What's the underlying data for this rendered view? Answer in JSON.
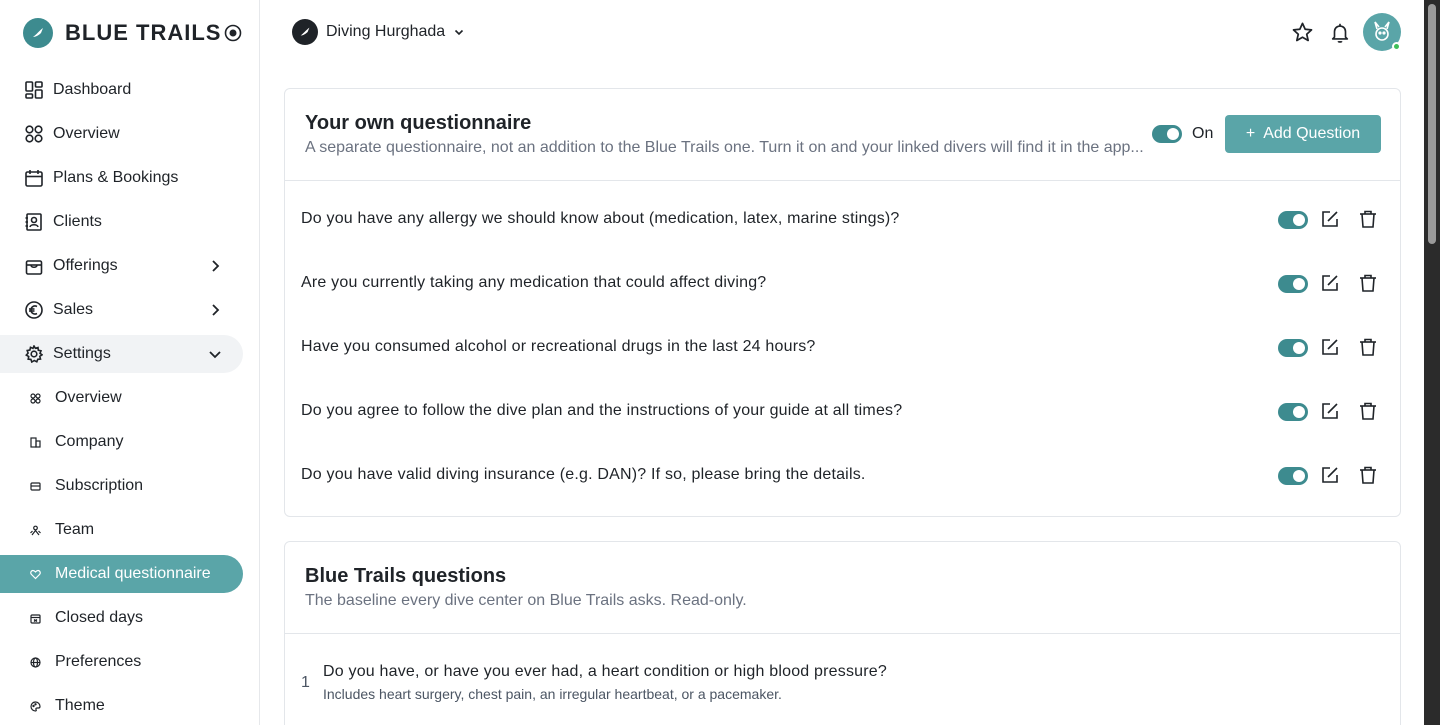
{
  "brand": {
    "name": "BLUE TRAILS"
  },
  "sidebar": {
    "items": [
      {
        "label": "Dashboard"
      },
      {
        "label": "Overview"
      },
      {
        "label": "Plans & Bookings"
      },
      {
        "label": "Clients"
      },
      {
        "label": "Offerings"
      },
      {
        "label": "Sales"
      },
      {
        "label": "Settings"
      }
    ],
    "settings_items": [
      {
        "label": "Overview"
      },
      {
        "label": "Company"
      },
      {
        "label": "Subscription"
      },
      {
        "label": "Team"
      },
      {
        "label": "Medical questionnaire"
      },
      {
        "label": "Closed days"
      },
      {
        "label": "Preferences"
      },
      {
        "label": "Theme"
      }
    ]
  },
  "header": {
    "center_name": "Diving Hurghada"
  },
  "own_questionnaire": {
    "title": "Your own questionnaire",
    "subtitle": "A separate questionnaire, not an addition to the Blue Trails one. Turn it on and your linked divers will find it in the app...",
    "toggle_label": "On",
    "add_button": "Add Question",
    "questions": [
      {
        "text": "Do you have any allergy we should know about (medication, latex, marine stings)?",
        "enabled": true
      },
      {
        "text": "Are you currently taking any medication that could affect diving?",
        "enabled": true
      },
      {
        "text": "Have you consumed alcohol or recreational drugs in the last 24 hours?",
        "enabled": true
      },
      {
        "text": "Do you agree to follow the dive plan and the instructions of your guide at all times?",
        "enabled": true
      },
      {
        "text": "Do you have valid diving insurance (e.g. DAN)? If so, please bring the details.",
        "enabled": true
      }
    ]
  },
  "blue_trails": {
    "title": "Blue Trails questions",
    "subtitle": "The baseline every dive center on Blue Trails asks. Read-only.",
    "questions": [
      {
        "number": "1",
        "text": "Do you have, or have you ever had, a heart condition or high blood pressure?",
        "hint": "Includes heart surgery, chest pain, an irregular heartbeat, or a pacemaker."
      }
    ]
  },
  "colors": {
    "accent": "#5aa5a8",
    "toggle": "#3d8b8f"
  }
}
